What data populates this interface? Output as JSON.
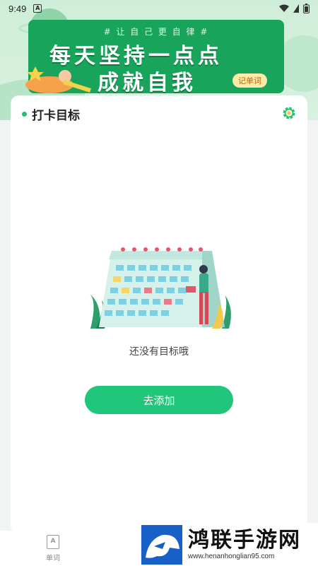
{
  "status_bar": {
    "time": "9:49",
    "app_icon_letter": "A"
  },
  "banner": {
    "tag": "# 让 自 己 更 自 律 #",
    "line1": "每天坚持一点点",
    "line2": "成就自我",
    "chip": "记单词"
  },
  "card": {
    "title": "打卡目标",
    "empty_text": "还没有目标哦",
    "add_button": "去添加"
  },
  "bottom_nav": {
    "items": [
      {
        "label": "单词",
        "icon": "book-icon"
      }
    ]
  },
  "watermark": {
    "title": "鸿联手游网",
    "url": "www.henanhonglian95.com"
  },
  "colors": {
    "accent": "#20c77a",
    "banner": "#19a45b"
  }
}
